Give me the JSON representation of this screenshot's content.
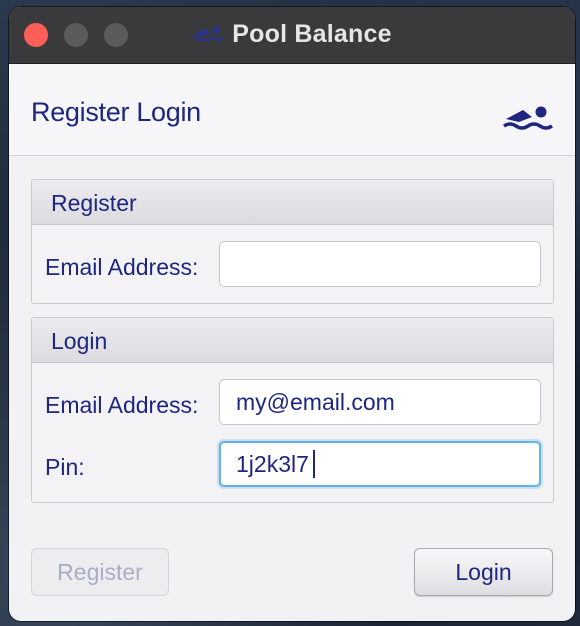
{
  "window": {
    "title": "Pool Balance",
    "title_icon": "swimmer-icon"
  },
  "header": {
    "title": "Register Login",
    "icon": "swimmer-icon"
  },
  "register_panel": {
    "title": "Register",
    "email_label": "Email Address:",
    "email_value": ""
  },
  "login_panel": {
    "title": "Login",
    "email_label": "Email Address:",
    "email_value": "my@email.com",
    "pin_label": "Pin:",
    "pin_value": "1j2k3l7"
  },
  "buttons": {
    "register_label": "Register",
    "login_label": "Login"
  },
  "colors": {
    "text": "#1f2680",
    "close_button": "#ff5f57",
    "focus_ring": "#64b3e6",
    "disabled_text": "#a9aec6"
  }
}
